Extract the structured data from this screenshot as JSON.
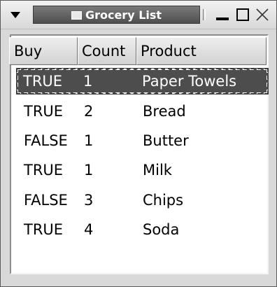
{
  "window": {
    "title": "Grocery List",
    "icons": {
      "menu": "triangle-down-icon",
      "app": "window-app-icon",
      "minimize": "minimize-icon",
      "maximize": "maximize-icon",
      "close": "close-icon"
    }
  },
  "table": {
    "columns": [
      "Buy",
      "Count",
      "Product"
    ],
    "rows": [
      {
        "buy": "TRUE",
        "count": "1",
        "product": "Paper Towels",
        "selected": true
      },
      {
        "buy": "TRUE",
        "count": "2",
        "product": "Bread"
      },
      {
        "buy": "FALSE",
        "count": "1",
        "product": "Butter"
      },
      {
        "buy": "TRUE",
        "count": "1",
        "product": "Milk"
      },
      {
        "buy": "FALSE",
        "count": "3",
        "product": "Chips"
      },
      {
        "buy": "TRUE",
        "count": "4",
        "product": "Soda"
      }
    ]
  },
  "colors": {
    "selection": "#4d4d4d",
    "title_plate": "#5f5f5f"
  }
}
